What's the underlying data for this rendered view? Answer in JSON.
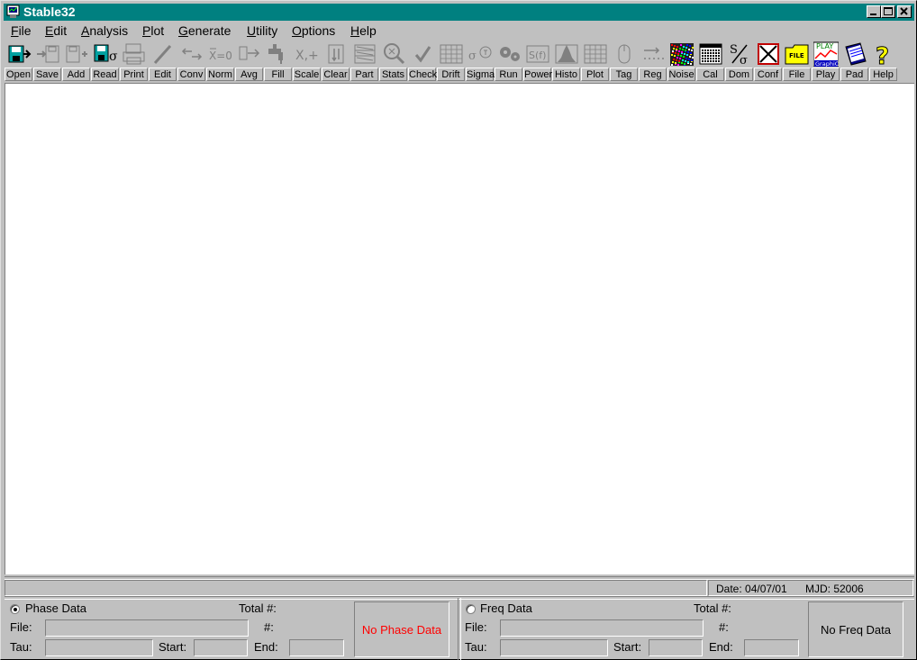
{
  "window": {
    "title": "Stable32"
  },
  "menu": [
    {
      "key": "F",
      "rest": "ile",
      "name": "menu-file"
    },
    {
      "key": "E",
      "rest": "dit",
      "name": "menu-edit"
    },
    {
      "key": "A",
      "rest": "nalysis",
      "name": "menu-analysis"
    },
    {
      "key": "P",
      "rest": "lot",
      "name": "menu-plot"
    },
    {
      "key": "G",
      "rest": "enerate",
      "name": "menu-generate"
    },
    {
      "key": "U",
      "rest": "tility",
      "name": "menu-utility"
    },
    {
      "key": "O",
      "rest": "ptions",
      "name": "menu-options"
    },
    {
      "key": "H",
      "rest": "elp",
      "name": "menu-help"
    }
  ],
  "toolbar": [
    {
      "label": "Open",
      "icon": "open-file-icon"
    },
    {
      "label": "Save",
      "icon": "save-icon"
    },
    {
      "label": "Add",
      "icon": "add-icon"
    },
    {
      "label": "Read",
      "icon": "read-sigma-icon"
    },
    {
      "label": "Print",
      "icon": "printer-icon"
    },
    {
      "label": "Edit",
      "icon": "pencil-icon"
    },
    {
      "label": "Conv",
      "icon": "convert-arrows-icon"
    },
    {
      "label": "Norm",
      "icon": "normalize-icon"
    },
    {
      "label": "Avg",
      "icon": "average-icon"
    },
    {
      "label": "Fill",
      "icon": "faucet-icon"
    },
    {
      "label": "Scale",
      "icon": "scale-icon"
    },
    {
      "label": "Clear",
      "icon": "clear-icon"
    },
    {
      "label": "Part",
      "icon": "part-icon"
    },
    {
      "label": "Stats",
      "icon": "magnifier-icon"
    },
    {
      "label": "Check",
      "icon": "checkmark-icon"
    },
    {
      "label": "Drift",
      "icon": "drift-grid-icon"
    },
    {
      "label": "Sigma",
      "icon": "sigma-tau-icon"
    },
    {
      "label": "Run",
      "icon": "gears-icon"
    },
    {
      "label": "Power",
      "icon": "power-sf-icon"
    },
    {
      "label": "Histo",
      "icon": "histogram-icon"
    },
    {
      "label": "Plot",
      "icon": "plot-grid-icon"
    },
    {
      "label": "Tag",
      "icon": "mouse-icon"
    },
    {
      "label": "Reg",
      "icon": "regression-icon"
    },
    {
      "label": "Noise",
      "icon": "noise-icon"
    },
    {
      "label": "Cal",
      "icon": "calendar-icon"
    },
    {
      "label": "Dom",
      "icon": "dom-sigma-icon"
    },
    {
      "label": "Conf",
      "icon": "conf-x-icon"
    },
    {
      "label": "File",
      "icon": "folder-file-icon"
    },
    {
      "label": "Play",
      "icon": "play-graphic-icon"
    },
    {
      "label": "Pad",
      "icon": "notepad-icon"
    },
    {
      "label": "Help",
      "icon": "question-icon"
    }
  ],
  "icon_text": {
    "sigma": "σ",
    "file": "FILE",
    "play": "PLAY",
    "graphic": "GraphiC",
    "sf": "S(f)",
    "norm": "X=0",
    "scale": "X,+"
  },
  "status": {
    "date": "Date: 04/07/01",
    "mjd": "MJD: 52006"
  },
  "phase": {
    "label": "Phase Data",
    "total": "Total #:",
    "file": "File:",
    "count": "#:",
    "tau": "Tau:",
    "start": "Start:",
    "end": "End:",
    "box": "No Phase Data",
    "box_color": "#ff0000",
    "selected": true
  },
  "freq": {
    "label": "Freq Data",
    "total": "Total #:",
    "file": "File:",
    "count": "#:",
    "tau": "Tau:",
    "start": "Start:",
    "end": "End:",
    "box": "No Freq Data",
    "box_color": "#000000",
    "selected": false
  }
}
